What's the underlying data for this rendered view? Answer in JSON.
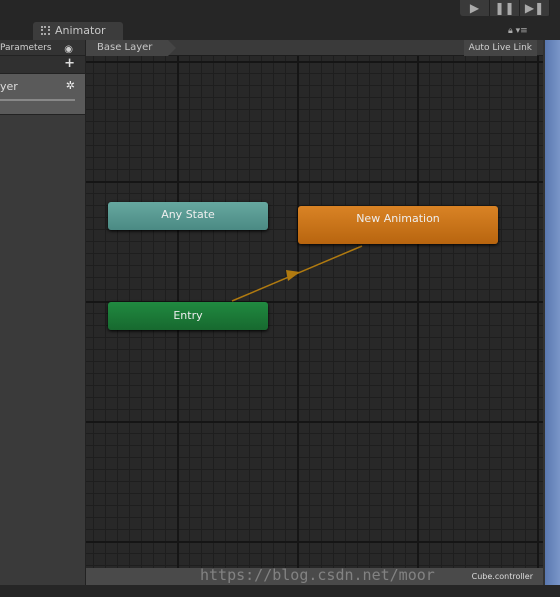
{
  "toolbar": {
    "play": "▶",
    "pause": "❚❚",
    "step": "▶❚"
  },
  "window": {
    "tab_title": "Animator"
  },
  "left_panel": {
    "tab_label": "Parameters",
    "layer_name": "yer"
  },
  "graph": {
    "breadcrumb": "Base Layer",
    "auto_live_link": "Auto Live Link",
    "nodes": {
      "any_state": "Any State",
      "new_animation": "New Animation",
      "entry": "Entry"
    },
    "colors": {
      "any_state": "#5a9e96",
      "new_animation": "#d87a12",
      "entry": "#1d7a3a",
      "transition": "#b07a10"
    }
  },
  "footer": {
    "status": "Cube.controller"
  },
  "watermark": "https://blog.csdn.net/moor"
}
